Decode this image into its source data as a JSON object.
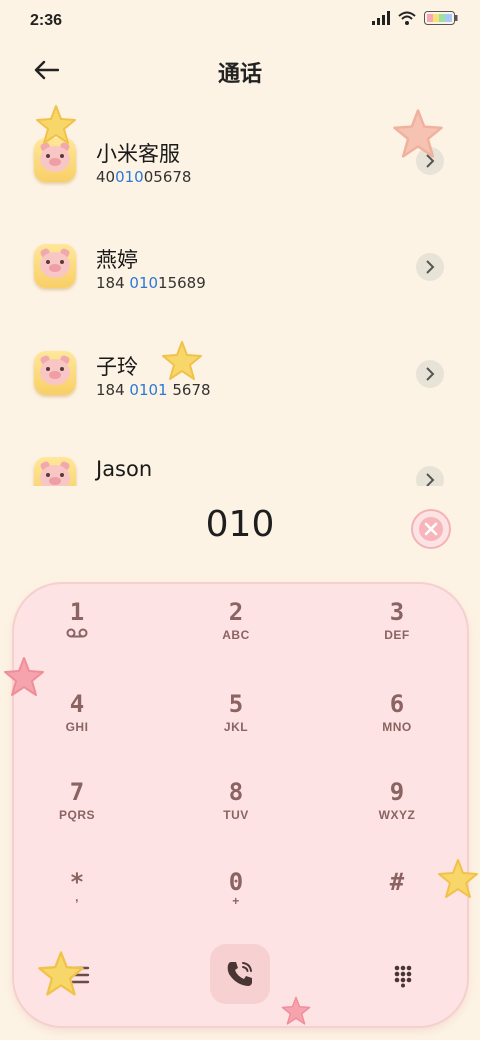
{
  "status": {
    "time": "2:36"
  },
  "header": {
    "title": "通话"
  },
  "contacts": [
    {
      "name": "小米客服",
      "num_a": "40",
      "num_hl": "010",
      "num_b": "05678"
    },
    {
      "name": "燕婷",
      "num_a": "184 ",
      "num_hl": "010",
      "num_b": "15689"
    },
    {
      "name": "子玲",
      "num_a": "184 ",
      "num_hl": "0101",
      "num_b": " 5678"
    },
    {
      "name": "Jason",
      "num_a": "",
      "num_hl": "",
      "num_b": ""
    }
  ],
  "dialer": {
    "input": "010"
  },
  "keys": [
    {
      "digit": "1",
      "letters": ""
    },
    {
      "digit": "2",
      "letters": "ABC"
    },
    {
      "digit": "3",
      "letters": "DEF"
    },
    {
      "digit": "4",
      "letters": "GHI"
    },
    {
      "digit": "5",
      "letters": "JKL"
    },
    {
      "digit": "6",
      "letters": "MNO"
    },
    {
      "digit": "7",
      "letters": "PQRS"
    },
    {
      "digit": "8",
      "letters": "TUV"
    },
    {
      "digit": "9",
      "letters": "WXYZ"
    },
    {
      "digit": "*",
      "letters": ","
    },
    {
      "digit": "0",
      "letters": "+"
    },
    {
      "digit": "#",
      "letters": ""
    }
  ],
  "icons": {
    "voicemail": "voicemail-icon",
    "call": "phone-call-icon",
    "menu": "menu-icon",
    "keypad": "keypad-grid-icon",
    "backspace": "backspace-icon"
  },
  "colors": {
    "background": "#fdf3e4",
    "keypad": "#fde3e3",
    "highlight": "#2b78d6",
    "key_text": "#8b6363"
  }
}
